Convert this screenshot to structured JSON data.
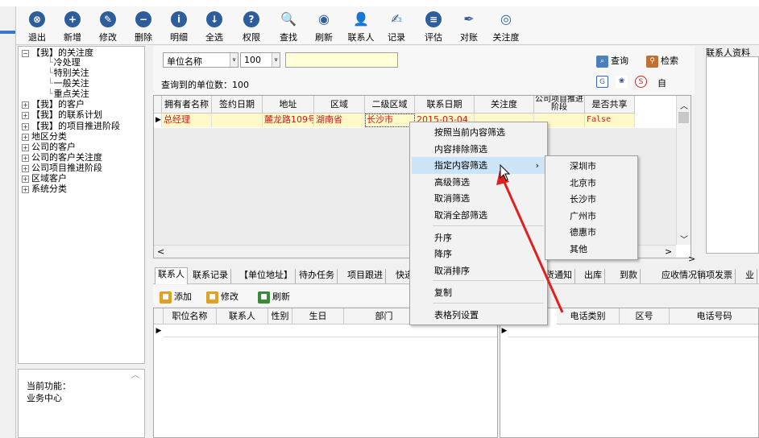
{
  "toolbar": [
    {
      "label": "退出",
      "icon": "exit-icon",
      "glyph": "⊗"
    },
    {
      "label": "新增",
      "icon": "add-icon",
      "glyph": "+"
    },
    {
      "label": "修改",
      "icon": "edit-icon",
      "glyph": "✎"
    },
    {
      "label": "删除",
      "icon": "delete-icon",
      "glyph": "−"
    },
    {
      "label": "明细",
      "icon": "info-icon",
      "glyph": "i"
    },
    {
      "label": "全选",
      "icon": "select-all-icon",
      "glyph": "↓"
    },
    {
      "label": "权限",
      "icon": "permission-icon",
      "glyph": "?"
    },
    {
      "label": "查找",
      "icon": "find-icon",
      "glyph": "🔍"
    },
    {
      "label": "刷新",
      "icon": "refresh-icon",
      "glyph": "◉"
    },
    {
      "label": "联系人",
      "icon": "contact-icon",
      "glyph": "👤"
    },
    {
      "label": "记录",
      "icon": "record-icon",
      "glyph": "✍"
    },
    {
      "label": "评估",
      "icon": "evaluate-icon",
      "glyph": "≡"
    },
    {
      "label": "对账",
      "icon": "reconcile-icon",
      "glyph": "✒"
    },
    {
      "label": "关注度",
      "icon": "attention-icon",
      "glyph": "◎"
    }
  ],
  "tree": [
    {
      "label": "【我】的关注度",
      "expander": "−",
      "level": 0
    },
    {
      "label": "冷处理",
      "expander": "",
      "level": 1
    },
    {
      "label": "特别关注",
      "expander": "",
      "level": 1
    },
    {
      "label": "一般关注",
      "expander": "",
      "level": 1
    },
    {
      "label": "重点关注",
      "expander": "",
      "level": 1
    },
    {
      "label": "【我】的客户",
      "expander": "+",
      "level": 0
    },
    {
      "label": "【我】的联系计划",
      "expander": "+",
      "level": 0
    },
    {
      "label": "【我】的项目推进阶段",
      "expander": "+",
      "level": 0
    },
    {
      "label": "地区分类",
      "expander": "+",
      "level": 0
    },
    {
      "label": "公司的客户",
      "expander": "+",
      "level": 0
    },
    {
      "label": "公司的客户关注度",
      "expander": "+",
      "level": 0
    },
    {
      "label": "公司项目推进阶段",
      "expander": "+",
      "level": 0
    },
    {
      "label": "区域客户",
      "expander": "+",
      "level": 0
    },
    {
      "label": "系统分类",
      "expander": "+",
      "level": 0
    }
  ],
  "function_panel": {
    "title": "当前功能：",
    "value": "业务中心"
  },
  "search": {
    "field_value": "单位名称",
    "count_value": "100",
    "keyword_value": "",
    "result_label": "查询到的单位数：100",
    "query_label": "查询",
    "retrieve_label": "检索",
    "custom_label": "自"
  },
  "grid": {
    "headers": [
      "拥有者名称",
      "签约日期",
      "地址",
      "区域",
      "二级区域",
      "联系日期",
      "关注度",
      "公司项目推进阶段",
      "是否共享"
    ],
    "row": [
      "总经理",
      "",
      "麓龙路109号",
      "湖南省",
      "长沙市",
      "2015-03-04",
      "",
      "",
      "False"
    ],
    "row_marker": "▶"
  },
  "right_panel_title": "联系人资料",
  "tabs": [
    "联系人",
    "联系记录",
    "【单位地址】",
    "待办任务",
    "项目跟进",
    "快递",
    "货通知",
    "出库",
    "到款",
    "应收情况",
    "销项发票",
    "业"
  ],
  "subtoolbar": [
    {
      "label": "添加",
      "icon": "add-contact-icon"
    },
    {
      "label": "修改",
      "icon": "edit-contact-icon"
    },
    {
      "label": "刷新",
      "icon": "refresh-contact-icon"
    }
  ],
  "contact_grid_headers": [
    "职位名称",
    "联系人",
    "性别",
    "生日",
    "部门"
  ],
  "phone_grid_headers": [
    "电话类别",
    "区号",
    "电话号码"
  ],
  "context_menu": {
    "items": [
      {
        "label": "按照当前内容筛选",
        "submenu": false
      },
      {
        "label": "内容排除筛选",
        "submenu": false
      },
      {
        "label": "指定内容筛选",
        "submenu": true
      },
      {
        "label": "高级筛选",
        "submenu": false
      },
      {
        "label": "取消筛选",
        "submenu": false
      },
      {
        "label": "取消全部筛选",
        "submenu": false
      },
      {
        "label": "升序",
        "submenu": false
      },
      {
        "label": "降序",
        "submenu": false
      },
      {
        "label": "取消排序",
        "submenu": false
      },
      {
        "label": "复制",
        "submenu": false
      },
      {
        "label": "表格列设置",
        "submenu": false
      }
    ],
    "highlighted": "指定内容筛选"
  },
  "submenu": {
    "items": [
      "深圳市",
      "北京市",
      "长沙市",
      "广州市",
      "德惠市",
      "其他"
    ]
  },
  "colors": {
    "accent": "#2d5d9b",
    "highlight": "#cce4f7",
    "cell_text": "#d81818",
    "annotation_arrow": "#e02020"
  }
}
